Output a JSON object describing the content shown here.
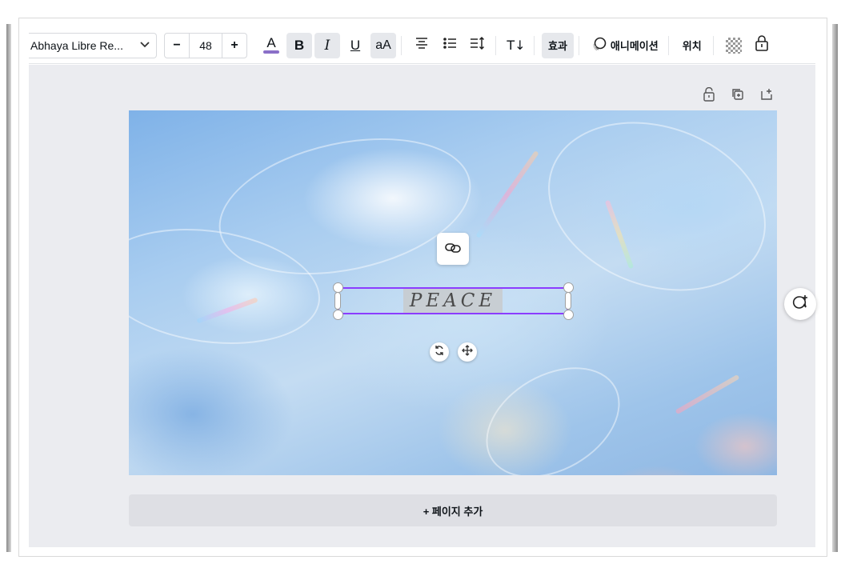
{
  "toolbar": {
    "font_name": "Abhaya Libre Re...",
    "font_size": "48",
    "minus_label": "−",
    "plus_label": "+",
    "text_color_label": "A",
    "bold_label": "B",
    "italic_label": "I",
    "underline_label": "U",
    "case_label": "aA",
    "spacing_label": "T↓",
    "effects_label": "효과",
    "animation_label": "애니메이션",
    "position_label": "위치",
    "text_color_bar": "#8a6fc8",
    "icons": [
      "chevron-down-icon",
      "align-center-icon",
      "bullet-list-icon",
      "line-spacing-icon",
      "text-spacing-icon",
      "animation-icon",
      "transparency-icon",
      "lock-icon"
    ]
  },
  "page_tools": {
    "icons": [
      "lock-icon",
      "duplicate-page-icon",
      "add-page-icon"
    ]
  },
  "canvas": {
    "text_element": "PEACE",
    "selection_color": "#8b3dff",
    "icons": [
      "link-icon",
      "rotate-icon",
      "move-icon",
      "add-comment-icon"
    ]
  },
  "footer": {
    "add_page_label": "+ 페이지 추가"
  }
}
